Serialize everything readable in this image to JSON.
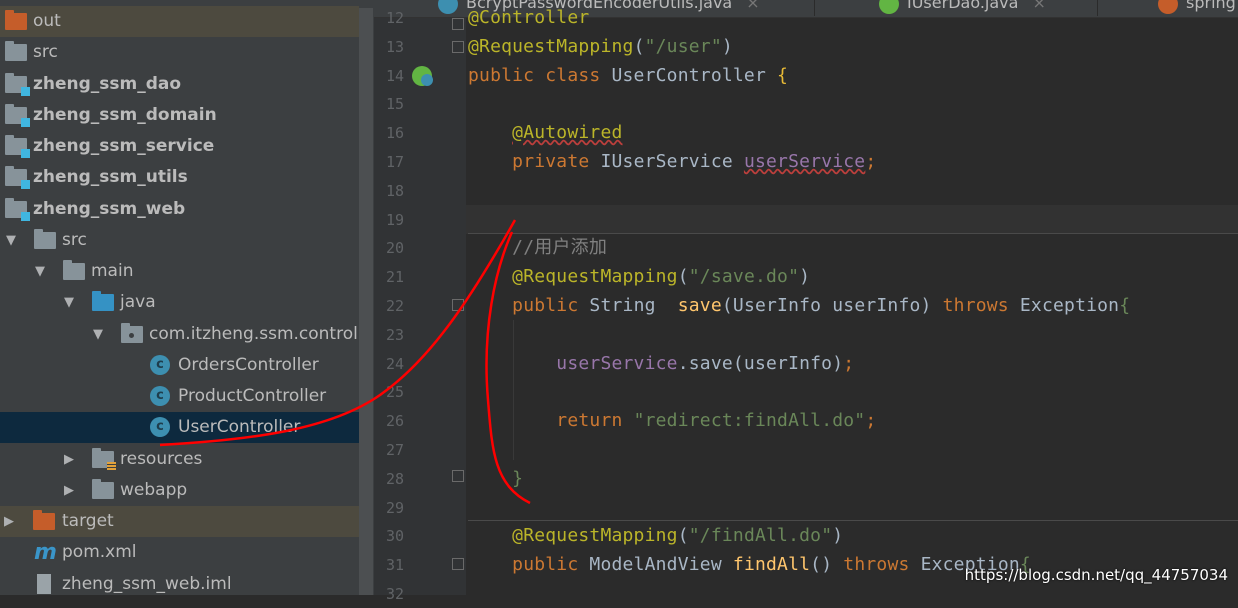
{
  "project_tree": [
    {
      "label": "out",
      "level": 0,
      "icon": "folder-orange",
      "arrow": "",
      "state": "excluded"
    },
    {
      "label": "src",
      "level": 0,
      "icon": "folder",
      "arrow": ""
    },
    {
      "label": "zheng_ssm_dao",
      "level": 0,
      "icon": "module",
      "arrow": "",
      "bold": true
    },
    {
      "label": "zheng_ssm_domain",
      "level": 0,
      "icon": "module",
      "arrow": "",
      "bold": true
    },
    {
      "label": "zheng_ssm_service",
      "level": 0,
      "icon": "module",
      "arrow": "",
      "bold": true
    },
    {
      "label": "zheng_ssm_utils",
      "level": 0,
      "icon": "module",
      "arrow": "",
      "bold": true
    },
    {
      "label": "zheng_ssm_web",
      "level": 0,
      "icon": "module",
      "arrow": "",
      "bold": true
    },
    {
      "label": "src",
      "level": 1,
      "icon": "folder",
      "arrow": "expanded"
    },
    {
      "label": "main",
      "level": 2,
      "icon": "folder",
      "arrow": "expanded"
    },
    {
      "label": "java",
      "level": 3,
      "icon": "folder-blue",
      "arrow": "expanded"
    },
    {
      "label": "com.itzheng.ssm.controll",
      "level": 4,
      "icon": "package",
      "arrow": "expanded"
    },
    {
      "label": "OrdersController",
      "level": 5,
      "icon": "class"
    },
    {
      "label": "ProductController",
      "level": 5,
      "icon": "class"
    },
    {
      "label": "UserController",
      "level": 5,
      "icon": "class",
      "state": "selected"
    },
    {
      "label": "resources",
      "level": 3,
      "icon": "resources",
      "arrow": "collapsed"
    },
    {
      "label": "webapp",
      "level": 3,
      "icon": "folder",
      "arrow": "collapsed"
    },
    {
      "label": "target",
      "level": 1,
      "icon": "folder-orange",
      "arrow": "collapsed",
      "state": "excluded",
      "arrow_level": 0
    },
    {
      "label": "pom.xml",
      "level": 1,
      "icon": "maven"
    },
    {
      "label": "zheng_ssm_web.iml",
      "level": 1,
      "icon": "iml"
    }
  ],
  "tabs": [
    {
      "label": "BcryptPasswordEncoderUtils.java",
      "color": "#3d8fb0"
    },
    {
      "label": "IUserDao.java",
      "color": "#62b543"
    },
    {
      "label": "spring",
      "color": "#c55d2a"
    }
  ],
  "tab_close": "×",
  "code_lines": [
    {
      "n": "12",
      "t": [
        [
          "a",
          "@Controller"
        ]
      ]
    },
    {
      "n": "13",
      "t": [
        [
          "a",
          "@RequestMapping"
        ],
        [
          "",
          "("
        ],
        [
          "s",
          "\"/user\""
        ],
        [
          "",
          ")"
        ]
      ]
    },
    {
      "n": "14",
      "t": [
        [
          "k",
          "public class "
        ],
        [
          "",
          "UserController "
        ],
        [
          "b",
          "{"
        ]
      ]
    },
    {
      "n": "15",
      "t": []
    },
    {
      "n": "16",
      "t": [
        [
          "",
          "    "
        ],
        [
          "a u",
          "@Autowired"
        ]
      ]
    },
    {
      "n": "17",
      "t": [
        [
          "",
          "    "
        ],
        [
          "k",
          "private "
        ],
        [
          "",
          "IUserService "
        ],
        [
          "f u",
          "userService"
        ],
        [
          "k",
          ";"
        ]
      ]
    },
    {
      "n": "18",
      "t": []
    },
    {
      "n": "19",
      "t": []
    },
    {
      "n": "20",
      "t": [
        [
          "",
          "    "
        ],
        [
          "c",
          "//用户添加"
        ]
      ]
    },
    {
      "n": "21",
      "t": [
        [
          "",
          "    "
        ],
        [
          "a",
          "@RequestMapping"
        ],
        [
          "",
          "("
        ],
        [
          "s",
          "\"/save.do\""
        ],
        [
          "",
          ")"
        ]
      ]
    },
    {
      "n": "22",
      "t": [
        [
          "",
          "    "
        ],
        [
          "k",
          "public "
        ],
        [
          "",
          "String  "
        ],
        [
          "m",
          "save"
        ],
        [
          "",
          "(UserInfo userInfo) "
        ],
        [
          "k",
          "throws "
        ],
        [
          "",
          "Exception"
        ],
        [
          "s",
          "{"
        ]
      ]
    },
    {
      "n": "23",
      "t": []
    },
    {
      "n": "24",
      "t": [
        [
          "",
          "        "
        ],
        [
          "f",
          "userService"
        ],
        [
          "",
          ".save(userInfo)"
        ],
        [
          "k",
          ";"
        ]
      ]
    },
    {
      "n": "25",
      "t": []
    },
    {
      "n": "26",
      "t": [
        [
          "",
          "        "
        ],
        [
          "k",
          "return "
        ],
        [
          "s",
          "\"redirect:findAll.do\""
        ],
        [
          "k",
          ";"
        ]
      ]
    },
    {
      "n": "27",
      "t": []
    },
    {
      "n": "28",
      "t": [
        [
          "",
          "    "
        ],
        [
          "s",
          "}"
        ]
      ]
    },
    {
      "n": "29",
      "t": []
    },
    {
      "n": "30",
      "t": [
        [
          "",
          "    "
        ],
        [
          "a",
          "@RequestMapping"
        ],
        [
          "",
          "("
        ],
        [
          "s",
          "\"/findAll.do\""
        ],
        [
          "",
          ")"
        ]
      ]
    },
    {
      "n": "31",
      "t": [
        [
          "",
          "    "
        ],
        [
          "k",
          "public "
        ],
        [
          "",
          "ModelAndView "
        ],
        [
          "m",
          "findAll"
        ],
        [
          "",
          "() "
        ],
        [
          "k",
          "throws "
        ],
        [
          "",
          "Exception"
        ],
        [
          "s",
          "{"
        ]
      ]
    },
    {
      "n": "32",
      "t": []
    }
  ],
  "watermark": "https://blog.csdn.net/qq_44757034",
  "annotation_color": "#ff0000"
}
